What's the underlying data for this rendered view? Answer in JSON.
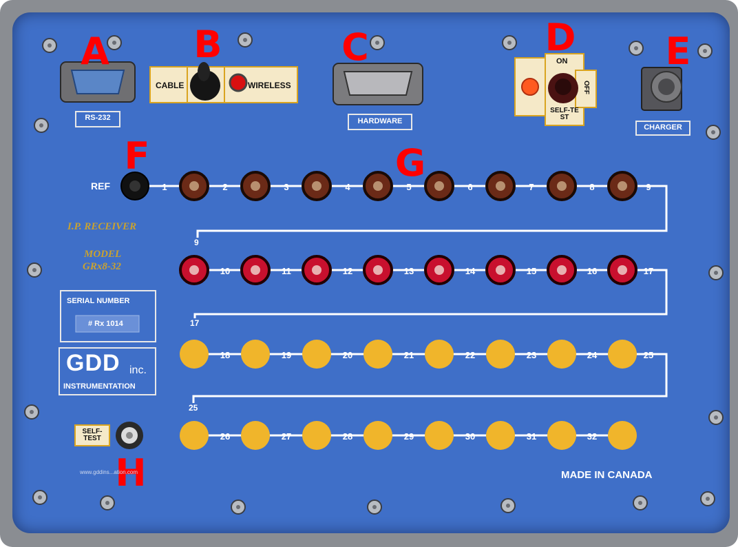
{
  "callouts": {
    "a": "A",
    "b": "B",
    "c": "C",
    "d": "D",
    "e": "E",
    "f": "F",
    "g": "G",
    "h": "H"
  },
  "ports": {
    "rs232": "RS-232",
    "hardware": "HARDWARE",
    "charger": "CHARGER"
  },
  "switch_b": {
    "cable": "CABLE",
    "wireless": "WIRELESS"
  },
  "switch_d": {
    "on": "ON",
    "off": "OFF",
    "self_test": "SELF-TEST"
  },
  "jacks": {
    "ref": "REF",
    "row1": [
      "1",
      "2",
      "3",
      "4",
      "5",
      "6",
      "7",
      "8",
      "9"
    ],
    "row2_start": "9",
    "row2": [
      "10",
      "11",
      "12",
      "13",
      "14",
      "15",
      "16",
      "17"
    ],
    "row3_start": "17",
    "row3": [
      "18",
      "19",
      "20",
      "21",
      "22",
      "23",
      "24",
      "25"
    ],
    "row4_start": "25",
    "row4": [
      "26",
      "27",
      "28",
      "29",
      "30",
      "31",
      "32"
    ]
  },
  "branding": {
    "receiver": "I.P. RECEIVER",
    "model_label": "MODEL",
    "model": "GRx8-32",
    "serial_label": "SERIAL NUMBER",
    "serial": "# Rx 1014",
    "logo": "GDD",
    "logo_suffix": "inc.",
    "instrumentation": "INSTRUMENTATION",
    "url": "www.gddins...ation.com",
    "origin": "MADE IN CANADA"
  },
  "self_test_button": "SELF-TEST",
  "colors": {
    "panel": "#3f6fc8",
    "jack_brown": "#6b2a17",
    "jack_red": "#c8102e",
    "pad_yellow": "#f0b52b",
    "callout": "#ff0000"
  }
}
